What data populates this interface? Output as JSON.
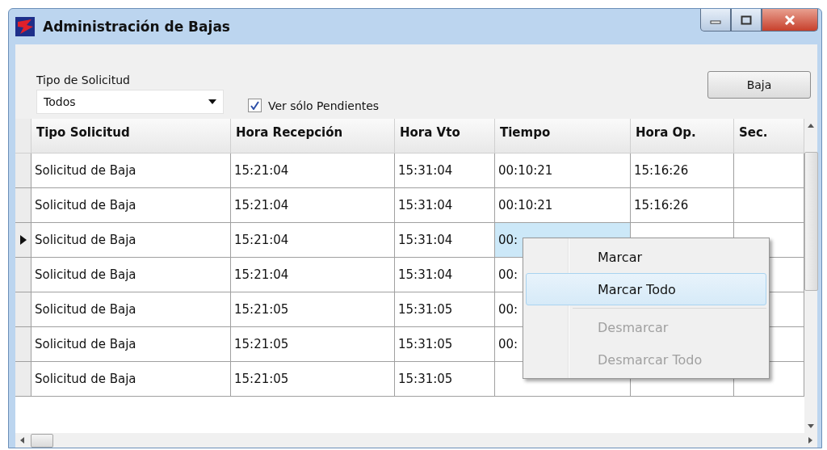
{
  "window": {
    "title": "Administración de Bajas"
  },
  "filter": {
    "label": "Tipo de Solicitud",
    "value": "Todos"
  },
  "pending_checkbox": {
    "label": "Ver sólo Pendientes",
    "checked": true
  },
  "action_button": "Baja",
  "table": {
    "columns": [
      "Tipo Solicitud",
      "Hora Recepción",
      "Hora Vto",
      "Tiempo",
      "Hora Op.",
      "Sec."
    ],
    "rows": [
      {
        "selected": false,
        "cells": [
          "Solicitud de Baja",
          "15:21:04",
          "15:31:04",
          "00:10:21",
          "15:16:26"
        ]
      },
      {
        "selected": false,
        "cells": [
          "Solicitud de Baja",
          "15:21:04",
          "15:31:04",
          "00:10:21",
          "15:16:26"
        ]
      },
      {
        "selected": true,
        "cells": [
          "Solicitud de Baja",
          "15:21:04",
          "15:31:04",
          "00:"
        ]
      },
      {
        "selected": false,
        "cells": [
          "Solicitud de Baja",
          "15:21:04",
          "15:31:04",
          "00:"
        ]
      },
      {
        "selected": false,
        "cells": [
          "Solicitud de Baja",
          "15:21:05",
          "15:31:05",
          "00:"
        ]
      },
      {
        "selected": false,
        "cells": [
          "Solicitud de Baja",
          "15:21:05",
          "15:31:05",
          "00:"
        ]
      },
      {
        "selected": false,
        "cells": [
          "Solicitud de Baja",
          "15:21:05",
          "15:31:05"
        ]
      }
    ]
  },
  "context_menu": [
    {
      "kind": "item",
      "label": "Marcar",
      "selected": false,
      "disabled": false
    },
    {
      "kind": "item",
      "label": "Marcar Todo",
      "selected": true,
      "disabled": false
    },
    {
      "kind": "separator"
    },
    {
      "kind": "item",
      "label": "Desmarcar",
      "selected": false,
      "disabled": true
    },
    {
      "kind": "item",
      "label": "Desmarcar Todo",
      "selected": false,
      "disabled": true
    }
  ]
}
